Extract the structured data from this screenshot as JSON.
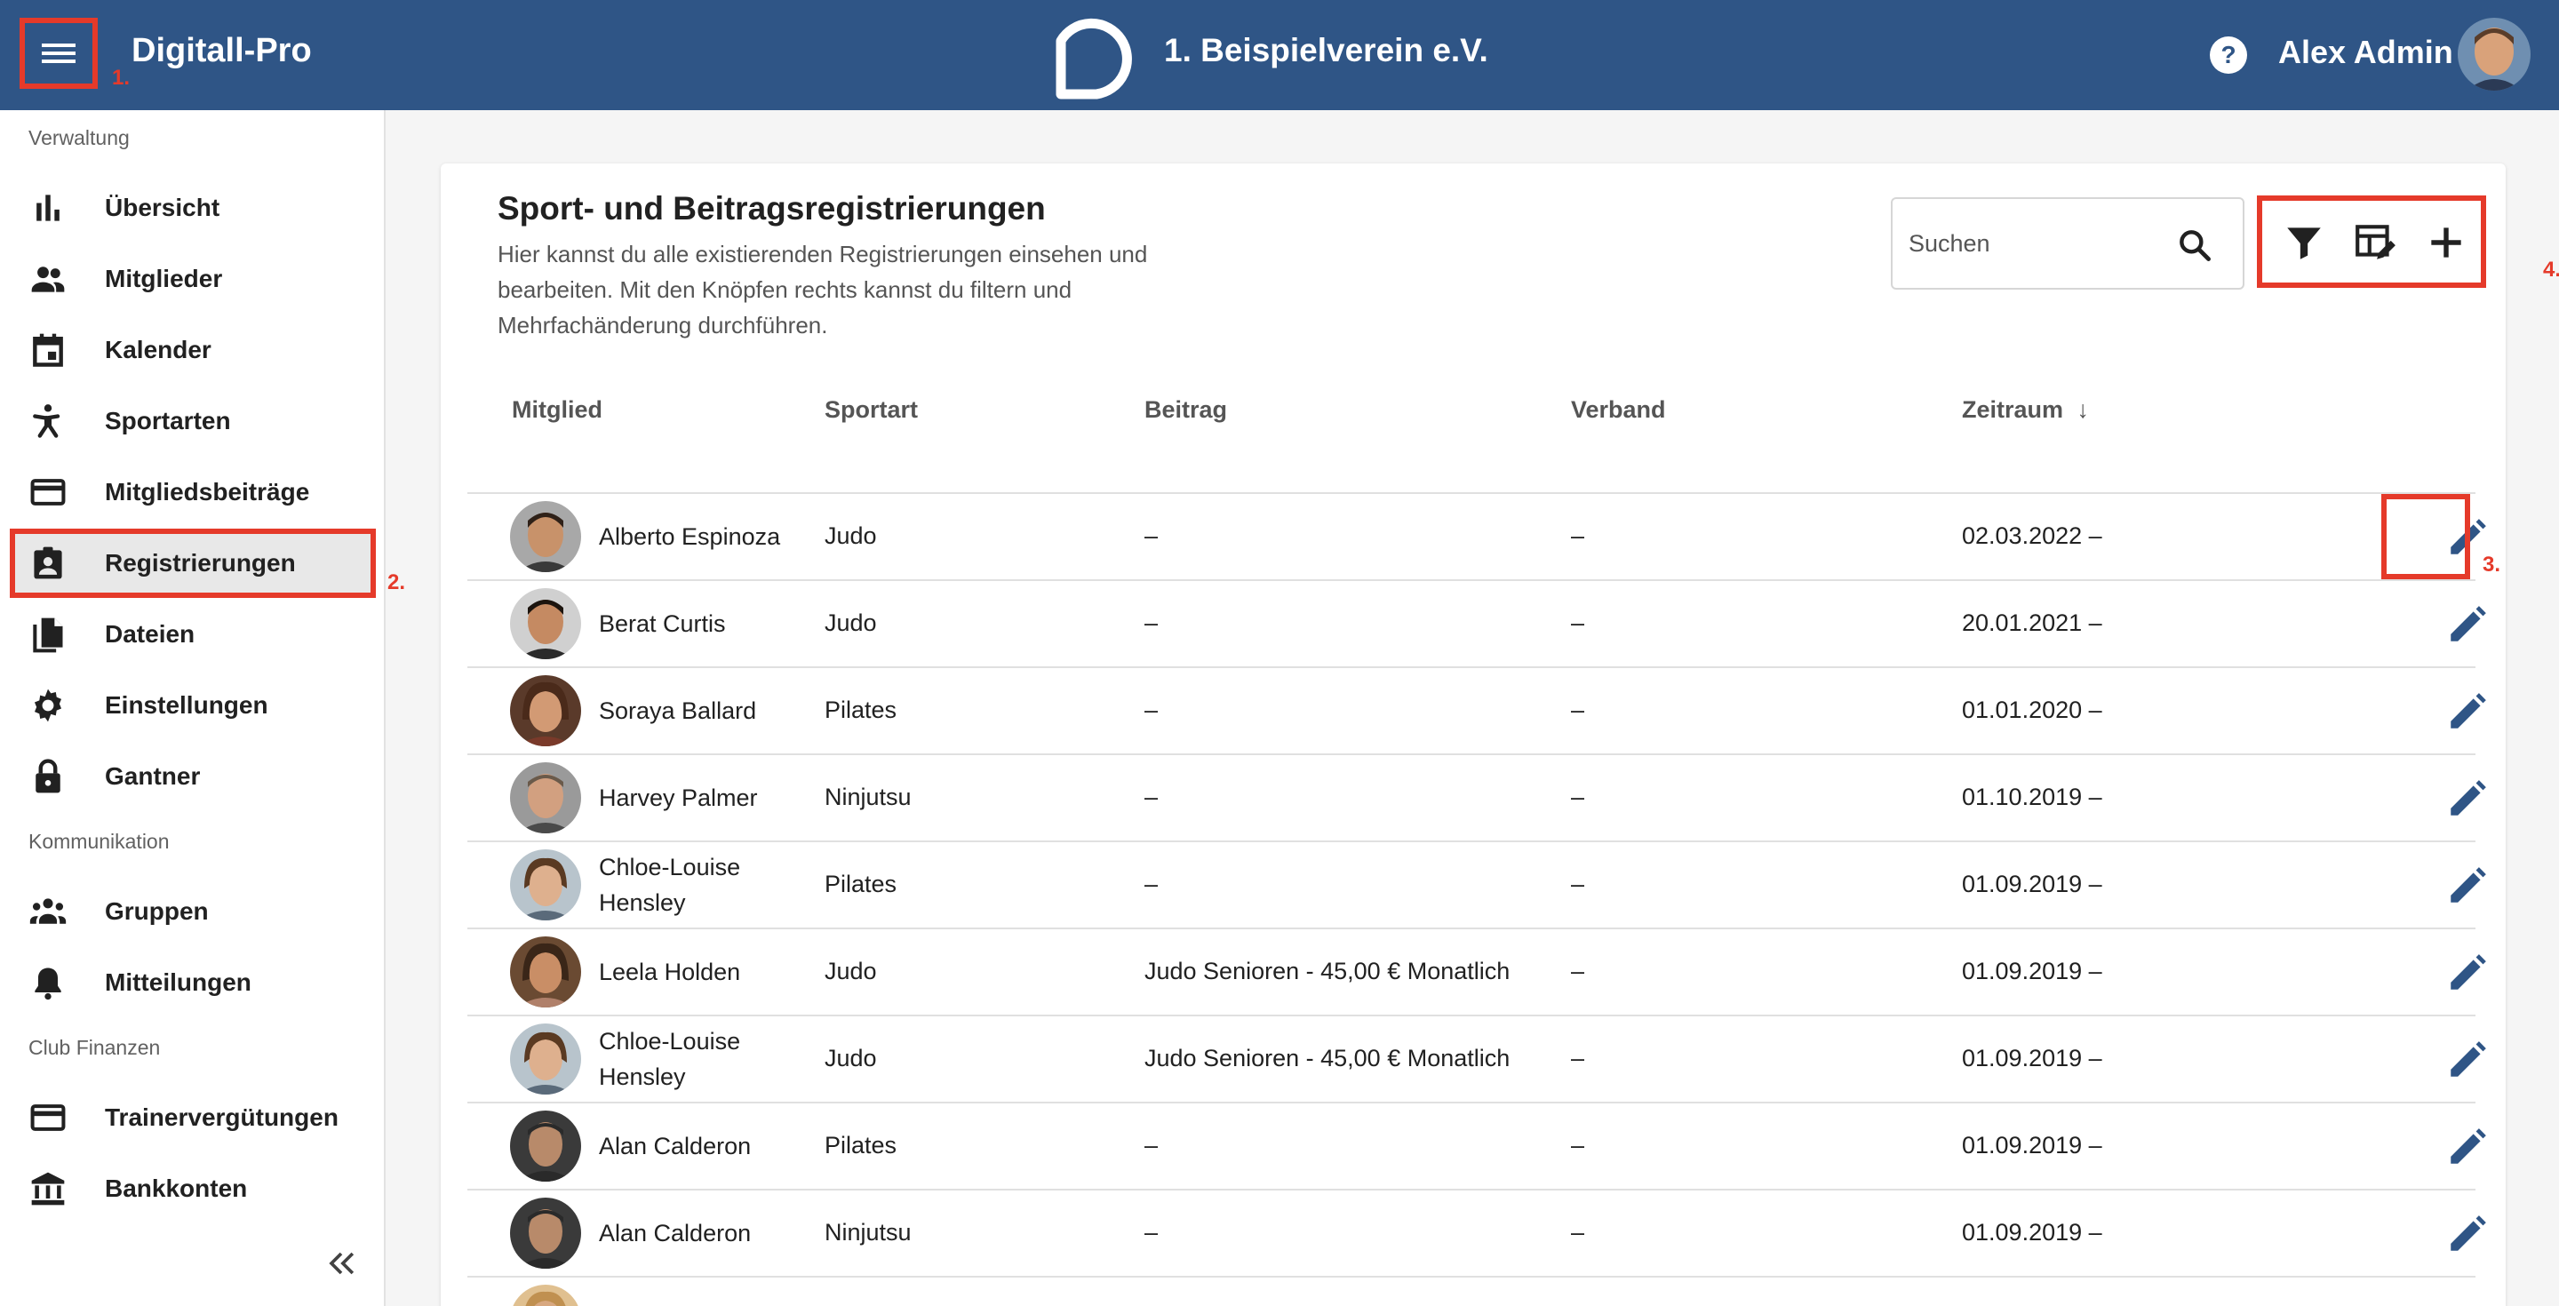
{
  "header": {
    "app_title": "Digitall-Pro",
    "club_title": "1. Beispielverein e.V.",
    "user_name": "Alex Admin",
    "bg_color": "#2f5586"
  },
  "annotations": {
    "a1": "1.",
    "a2": "2.",
    "a3": "3.",
    "a4": "4."
  },
  "sidebar": {
    "sections": [
      "Verwaltung",
      "Kommunikation",
      "Club Finanzen"
    ],
    "items": [
      {
        "label": "Übersicht",
        "icon": "bar-chart-icon"
      },
      {
        "label": "Mitglieder",
        "icon": "people-icon"
      },
      {
        "label": "Kalender",
        "icon": "calendar-icon"
      },
      {
        "label": "Sportarten",
        "icon": "sport-icon"
      },
      {
        "label": "Mitgliedsbeiträge",
        "icon": "credit-card-icon"
      },
      {
        "label": "Registrierungen",
        "icon": "badge-icon",
        "active": true
      },
      {
        "label": "Dateien",
        "icon": "file-icon"
      },
      {
        "label": "Einstellungen",
        "icon": "gear-icon"
      },
      {
        "label": "Gantner",
        "icon": "lock-icon"
      },
      {
        "label": "Gruppen",
        "icon": "groups-icon"
      },
      {
        "label": "Mitteilungen",
        "icon": "bell-icon"
      },
      {
        "label": "Trainervergütungen",
        "icon": "credit-card-icon"
      },
      {
        "label": "Bankkonten",
        "icon": "bank-icon"
      }
    ]
  },
  "main": {
    "title": "Sport- und Beitragsregistrierungen",
    "description": "Hier kannst du alle existierenden Registrierungen einsehen und bearbeiten. Mit den Knöpfen rechts kannst du filtern und Mehrfachänderung durchführen.",
    "search_placeholder": "Suchen",
    "columns": [
      "Mitglied",
      "Sportart",
      "Beitrag",
      "Verband",
      "Zeitraum"
    ],
    "sort_indicator": "↓",
    "rows": [
      {
        "name": "Alberto Espinoza",
        "sport": "Judo",
        "fee": "–",
        "association": "–",
        "period": "02.03.2022 –"
      },
      {
        "name": "Berat Curtis",
        "sport": "Judo",
        "fee": "–",
        "association": "–",
        "period": "20.01.2021 –"
      },
      {
        "name": "Soraya Ballard",
        "sport": "Pilates",
        "fee": "–",
        "association": "–",
        "period": "01.01.2020 –"
      },
      {
        "name": "Harvey Palmer",
        "sport": "Ninjutsu",
        "fee": "–",
        "association": "–",
        "period": "01.10.2019 –"
      },
      {
        "name": "Chloe-Louise Hensley",
        "sport": "Pilates",
        "fee": "–",
        "association": "–",
        "period": "01.09.2019 –"
      },
      {
        "name": "Leela Holden",
        "sport": "Judo",
        "fee": "Judo Senioren - 45,00 € Monatlich",
        "association": "–",
        "period": "01.09.2019 –"
      },
      {
        "name": "Chloe-Louise Hensley",
        "sport": "Judo",
        "fee": "Judo Senioren - 45,00 € Monatlich",
        "association": "–",
        "period": "01.09.2019 –"
      },
      {
        "name": "Alan Calderon",
        "sport": "Pilates",
        "fee": "–",
        "association": "–",
        "period": "01.09.2019 –"
      },
      {
        "name": "Alan Calderon",
        "sport": "Ninjutsu",
        "fee": "–",
        "association": "–",
        "period": "01.09.2019 –"
      }
    ]
  }
}
